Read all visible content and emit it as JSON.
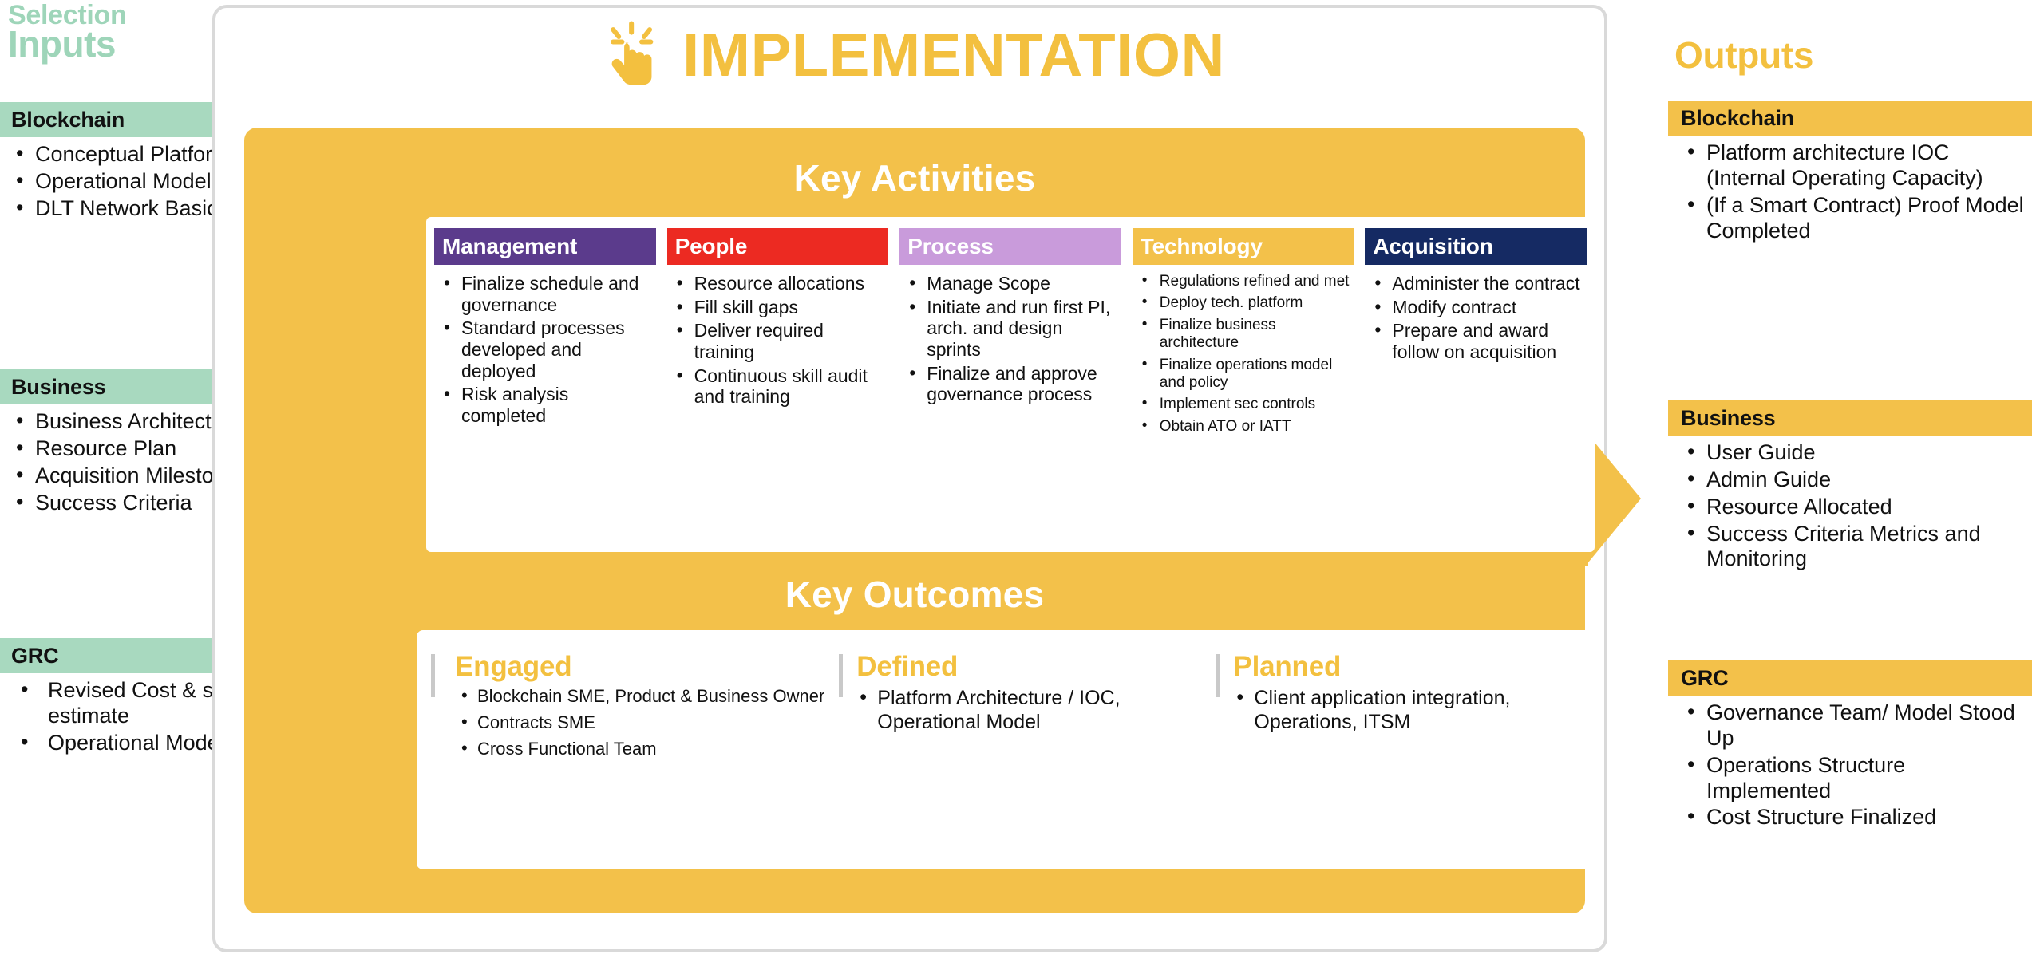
{
  "inputs": {
    "eyebrow": "Selection",
    "title": "Inputs",
    "groups": [
      {
        "label": "Blockchain",
        "items": [
          "Conceptual Platform Architecture",
          "Operational Model",
          "DLT Network Basics"
        ]
      },
      {
        "label": "Business",
        "items": [
          "Business Architecture",
          "Resource Plan",
          "Acquisition Milestones",
          "Success Criteria"
        ]
      },
      {
        "label": "GRC",
        "items": [
          "Revised Cost & schedule estimate",
          "Operational Model"
        ]
      }
    ]
  },
  "main": {
    "title": "IMPLEMENTATION",
    "title_icon": "tap-hand-icon",
    "key_activities_heading": "Key Activities",
    "key_outcomes_heading": "Key Outcomes",
    "activities": [
      {
        "label": "Management",
        "color": "#5b3b8c",
        "items": [
          "Finalize schedule and governance",
          "Standard processes developed and deployed",
          "Risk analysis completed"
        ]
      },
      {
        "label": "People",
        "color": "#ec2a22",
        "items": [
          "Resource allocations",
          "Fill skill gaps",
          "Deliver required training",
          "Continuous skill audit and training"
        ]
      },
      {
        "label": "Process",
        "color": "#c99bdb",
        "items": [
          "Manage Scope",
          "Initiate and run first PI, arch. and design sprints",
          "Finalize and approve governance process"
        ]
      },
      {
        "label": "Technology",
        "color": "#f3c14a",
        "items": [
          "Regulations refined and met",
          "Deploy tech. platform",
          "Finalize business architecture",
          "Finalize operations model and policy",
          "Implement sec controls",
          "Obtain ATO or IATT"
        ]
      },
      {
        "label": "Acquisition",
        "color": "#152a63",
        "items": [
          "Administer the contract",
          "Modify contract",
          "Prepare and award follow on acquisition"
        ]
      }
    ],
    "outcomes": [
      {
        "label": "Engaged",
        "items": [
          "Blockchain SME, Product & Business Owner",
          "Contracts SME",
          "Cross Functional Team"
        ]
      },
      {
        "label": "Defined",
        "items": [
          "Platform Architecture / IOC, Operational Model"
        ]
      },
      {
        "label": "Planned",
        "items": [
          "Client application integration, Operations, ITSM"
        ]
      }
    ]
  },
  "outputs": {
    "title": "Outputs",
    "groups": [
      {
        "label": "Blockchain",
        "items": [
          "Platform architecture IOC (Internal Operating Capacity)",
          "(If a Smart Contract) Proof Model Completed"
        ]
      },
      {
        "label": "Business",
        "items": [
          "User Guide",
          "Admin Guide",
          "Resource Allocated",
          "Success Criteria Metrics and Monitoring"
        ]
      },
      {
        "label": "GRC",
        "items": [
          "Governance Team/ Model Stood Up",
          "Operations Structure Implemented",
          "Cost Structure Finalized"
        ]
      }
    ]
  },
  "colors": {
    "input_band": "#a8d9bf",
    "input_title": "#9ed5b9",
    "output_band": "#f3c14a",
    "accent_yellow": "#f3c03f",
    "frame_gray": "#d9d9d9"
  }
}
